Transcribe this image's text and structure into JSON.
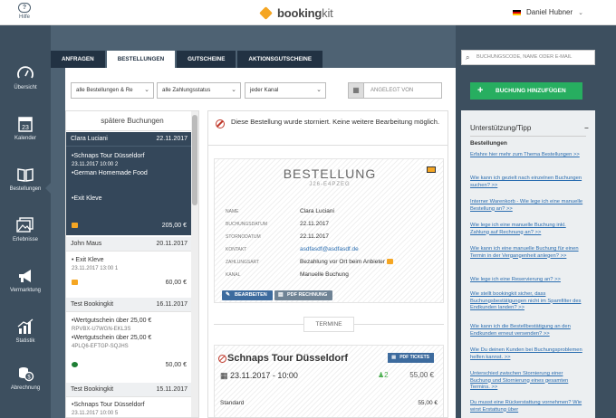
{
  "header": {
    "help_label": "Hilfe",
    "brand_bold": "booking",
    "brand_light": "kit",
    "user_name": "Daniel Hubner"
  },
  "nav": [
    {
      "label": "Übersicht"
    },
    {
      "label": "Kalender",
      "day": "23"
    },
    {
      "label": "Bestellungen"
    },
    {
      "label": "Erlebnisse"
    },
    {
      "label": "Vermarktung"
    },
    {
      "label": "Statistik"
    },
    {
      "label": "Abrechnung"
    }
  ],
  "tabs": [
    {
      "label": "ANFRAGEN"
    },
    {
      "label": "BESTELLUNGEN"
    },
    {
      "label": "GUTSCHEINE"
    },
    {
      "label": "AKTIONSGUTSCHEINE"
    }
  ],
  "filters": {
    "booking_filter": "alle Bestellungen & Re",
    "payment_filter": "alle Zahlungsstatus",
    "channel_filter": "jeder Kanal",
    "date_placeholder": "ANGELEGT VON"
  },
  "search": {
    "placeholder": "BUCHUNGSCODE, NAME ODER E-MAIL"
  },
  "add_button": {
    "label": "BUCHUNG HINZUFÜGEN"
  },
  "list": {
    "header": "spätere Buchungen",
    "bookings": [
      {
        "name": "Clara Luciani",
        "date": "22.11.2017",
        "items": [
          {
            "title": "•Schnaps Tour Düsseldorf",
            "sub": "23.11.2017 10:00  2"
          },
          {
            "title": "•German Homemade Food",
            "sub": ""
          },
          {
            "title": "",
            "sub": ""
          },
          {
            "title": "•Exit Kleve",
            "sub": ""
          }
        ],
        "total": "205,00 €"
      },
      {
        "name": "John Maus",
        "date": "20.11.2017",
        "items": [
          {
            "title": "• Exit Kleve",
            "sub": "23.11.2017 13:00  1"
          }
        ],
        "total": "60,00 €"
      },
      {
        "name": "Test Bookingkit",
        "date": "16.11.2017",
        "items": [
          {
            "title": "•Wertgutschein über 25,00 €",
            "sub": "RPVBX-U7WGN-EKL3S"
          },
          {
            "title": "•Wertgutschein über 25,00 €",
            "sub": "4PLQ6-EFTGP-SQJHS"
          }
        ],
        "total": "50,00 €"
      },
      {
        "name": "Test Bookingkit",
        "date": "15.11.2017",
        "items": [
          {
            "title": "•Schnaps Tour Düsseldorf",
            "sub": "23.11.2017 10:00  5"
          }
        ],
        "total": ""
      }
    ]
  },
  "detail": {
    "cancel_notice": "Diese Bestellung wurde storniert. Keine weitere Bearbeitung möglich.",
    "order_title": "BESTELLUNG",
    "order_code": "J26-E4PZEG",
    "fields": [
      {
        "key": "Name",
        "value": "Clara Luciani"
      },
      {
        "key": "Buchungsdatum",
        "value": "22.11.2017"
      },
      {
        "key": "Stornodatum",
        "value": "22.11.2017"
      },
      {
        "key": "Kontakt",
        "value": "asdfasdf@asdfasdf.de"
      },
      {
        "key": "Zahlungsart",
        "value": "Bezahlung vor Ort beim Anbieter"
      },
      {
        "key": "Kanal",
        "value": "Manuelle Buchung"
      }
    ],
    "edit_button": "BEARBEITEN",
    "pdf_button": "PDF RECHNUNG",
    "termine_label": "TERMINE",
    "tour": {
      "title": "Schnaps Tour Düsseldorf",
      "date": "23.11.2017 - 10:00",
      "people": "2",
      "price": "55,00 €",
      "ticket_button": "PDF TICKETS",
      "row_label": "Standard",
      "row_value": "55,00 €"
    }
  },
  "help": {
    "title": "Unterstützung/Tipp",
    "section": "Bestellungen",
    "links": [
      "Erfahre hier mehr zum Thema Bestellungen >>",
      "Wie kann ich gezielt nach einzelnen Buchungen suchen? >>",
      "Interner Warenkorb - Wie lege ich eine manuelle Bestellung an? >>",
      "Wie lege ich eine manuelle Buchung inkl. Zahlung auf Rechnung an? >>",
      "Wie kann ich eine manuelle Buchung für einen Termin in der Vergangenheit anlegen? >>",
      "Wie lege ich eine Reservierung an? >>",
      "Wie stellt bookingkit sicher, dass Buchungsbestätigungen nicht im Spamfilter des Endkunden landen? >>",
      "Wie kann ich die Bestellbestätigung an den Endkunden erneut versenden? >>",
      "Wie Du deinen Kunden bei Buchungsproblemen helfen kannst. >>",
      "Unterschied zwischen Stornierung einer Buchung und Stornierung eines gesamten Termins. >>",
      "Du musst eine Rückerstattung vornehmen? Wie wirst Erstattung über"
    ]
  },
  "colors": {
    "nav_bg": "#3d4f5f",
    "accent_green": "#27ae60",
    "tab_dark": "#223243",
    "cancel_red": "#c0392b",
    "link_blue": "#2a6db0"
  }
}
